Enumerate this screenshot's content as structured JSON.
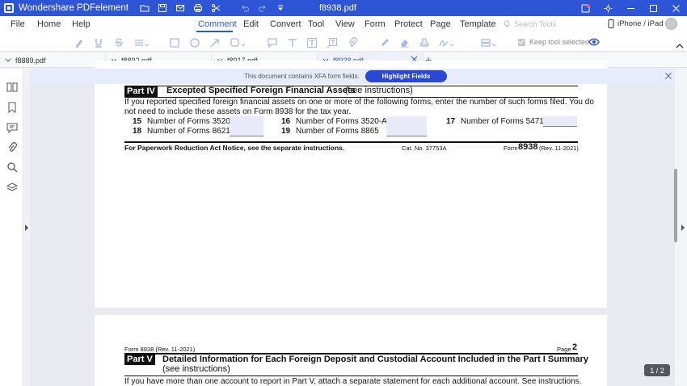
{
  "app": {
    "name": "Wondershare PDFelement",
    "doc_title": "f8938.pdf",
    "brand_color": "#2d55d6"
  },
  "menu": {
    "items": [
      "File",
      "Home",
      "Help",
      "Comment",
      "Edit",
      "Convert",
      "Tool",
      "View",
      "Form",
      "Protect",
      "Page",
      "Template"
    ],
    "active": "Comment",
    "search_placeholder": "Search Tools",
    "device_label": "iPhone / iPad"
  },
  "ribbon": {
    "keep_tool_label": "Keep tool selected",
    "tools": [
      "highlight-icon",
      "underline-icon",
      "strikethrough-icon",
      "text-menu-icon",
      "rectangle-icon",
      "ellipse-icon",
      "arrow-icon",
      "shape-menu-icon",
      "note-icon",
      "typewriter-icon",
      "textbox-icon",
      "callout-icon",
      "attachment-icon",
      "pencil-icon",
      "eraser-icon",
      "stamp-icon",
      "signature-icon",
      "area-highlight-icon"
    ]
  },
  "tabs": [
    {
      "label": "f8889.pdf",
      "active": false
    },
    {
      "label": "f8892.pdf",
      "active": false
    },
    {
      "label": "f8917.pdf",
      "active": false
    },
    {
      "label": "f8938.pdf",
      "active": true
    }
  ],
  "sidebar": {
    "icons": [
      "thumbnails-icon",
      "bookmark-icon",
      "comments-icon",
      "attachment-icon",
      "search-icon",
      "layers-icon"
    ]
  },
  "xfa": {
    "message": "This document contains XFA form fields.",
    "button": "Highlight Fields"
  },
  "page1": {
    "part_tag": "Part IV",
    "part_title": "Excepted Specified Foreign Financial Assets",
    "part_title_suffix": "(see instructions)",
    "intro_line1": "If you reported specified foreign financial assets on one or more of the following forms, enter the number of such forms filed. You do",
    "intro_line2": "not need to include these assets on Form 8938 for the tax year.",
    "lines": [
      {
        "num": "15",
        "label": "Number of Forms 3520"
      },
      {
        "num": "16",
        "label": "Number of Forms 3520-A"
      },
      {
        "num": "17",
        "label": "Number of Forms 5471"
      },
      {
        "num": "18",
        "label": "Number of Forms 8621"
      },
      {
        "num": "19",
        "label": "Number of Forms 8865"
      }
    ],
    "footer_notice": "For Paperwork Reduction Act Notice, see the separate instructions.",
    "cat_no": "Cat. No. 37753A",
    "form_label": "Form",
    "form_number": "8938",
    "form_rev": "(Rev. 11-2021)"
  },
  "page2": {
    "header_left": "Form 8938 (Rev. 11-2021)",
    "page_label": "Page",
    "page_number": "2",
    "part_tag": "Part V",
    "part_title": "Detailed Information for Each Foreign Deposit and Custodial Account Included in the Part I Summary",
    "part_title_suffix": "(see instructions)",
    "intro": "If you have more than one account to report in Part V, attach a separate statement for each additional account. See instructions."
  },
  "status": {
    "page_indicator": "1 / 2"
  }
}
